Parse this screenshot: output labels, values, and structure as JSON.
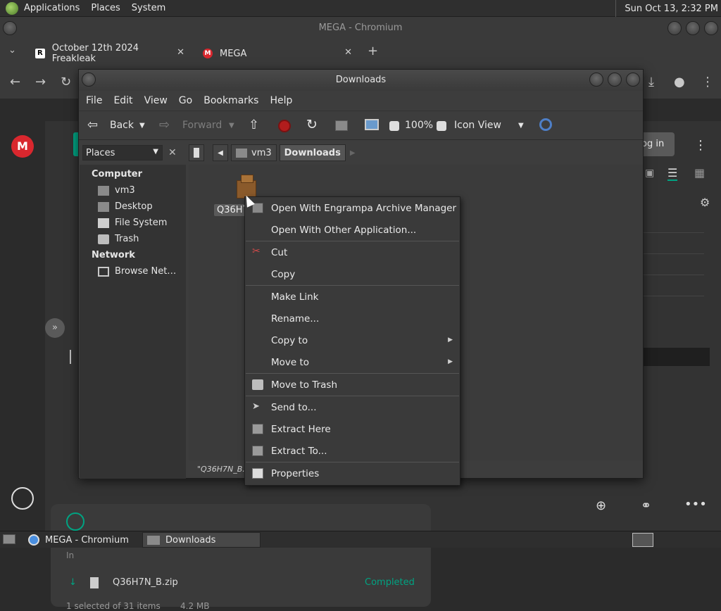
{
  "top_panel": {
    "menus": [
      "Applications",
      "Places",
      "System"
    ],
    "clock": "Sun Oct 13,  2:32 PM"
  },
  "chromium": {
    "window_title": "MEGA - Chromium",
    "tabs": [
      {
        "label": "October 12th 2024 Freakleak",
        "favicon": "R"
      },
      {
        "label": "MEGA",
        "favicon": "M"
      }
    ],
    "new_tab": "+",
    "page": {
      "login_label": "Log in",
      "download_filename": "Q36H7N_B.zip",
      "download_status": "Completed",
      "selection_summary": "1 selected of 31 items",
      "selection_size": "4.2 MB"
    }
  },
  "caja": {
    "window_title": "Downloads",
    "menubar": [
      "File",
      "Edit",
      "View",
      "Go",
      "Bookmarks",
      "Help"
    ],
    "toolbar": {
      "back": "Back",
      "forward": "Forward",
      "zoom": "100%",
      "view_mode": "Icon View"
    },
    "sidebar_selector": "Places",
    "sidebar": {
      "computer_header": "Computer",
      "computer_items": [
        "vm3",
        "Desktop",
        "File System",
        "Trash"
      ],
      "network_header": "Network",
      "network_items": [
        "Browse Net…"
      ]
    },
    "path": [
      "vm3",
      "Downloads"
    ],
    "file_label": "Q36H7",
    "status_text": "\"Q36H7N_B.z"
  },
  "context_menu": {
    "items": [
      {
        "label": "Open With Engrampa Archive Manager",
        "icon": "archive-icon"
      },
      {
        "label": "Open With Other Application...",
        "icon": ""
      },
      {
        "label": "Cut",
        "icon": "scissors-icon"
      },
      {
        "label": "Copy",
        "icon": ""
      },
      {
        "label": "Make Link",
        "icon": ""
      },
      {
        "label": "Rename...",
        "icon": ""
      },
      {
        "label": "Copy to",
        "icon": "",
        "submenu": true
      },
      {
        "label": "Move to",
        "icon": "",
        "submenu": true
      },
      {
        "label": "Move to Trash",
        "icon": "trash-icon"
      },
      {
        "label": "Send to...",
        "icon": "send-icon"
      },
      {
        "label": "Extract Here",
        "icon": "extract-icon"
      },
      {
        "label": "Extract To...",
        "icon": "extract-icon"
      },
      {
        "label": "Properties",
        "icon": "properties-icon"
      }
    ]
  },
  "taskbar": {
    "items": [
      "MEGA - Chromium",
      "Downloads"
    ]
  },
  "colors": {
    "mega_red": "#d9272e",
    "accent_green": "#00a382"
  }
}
